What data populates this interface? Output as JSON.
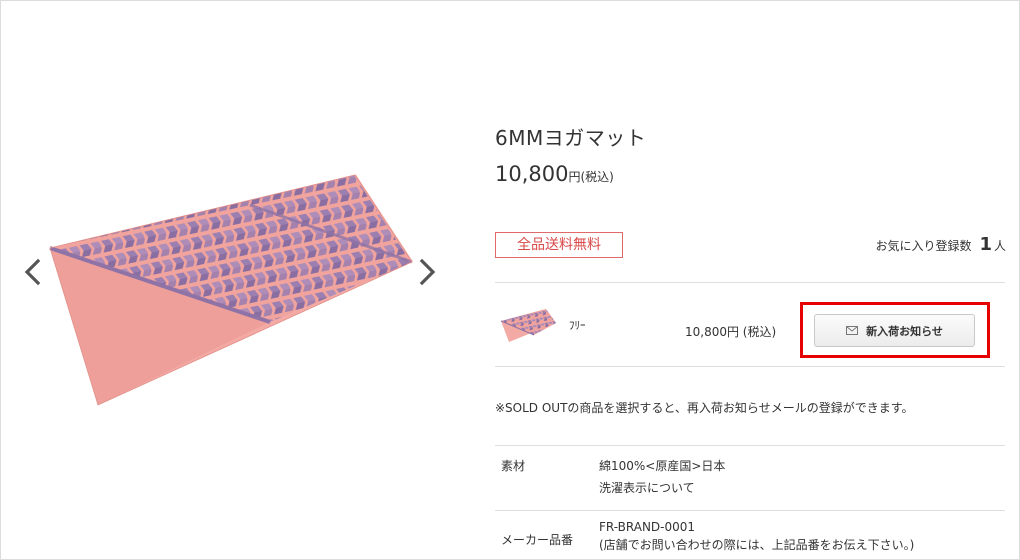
{
  "product": {
    "title": "6MMヨガマット",
    "price": "10,800",
    "price_unit": "円(税込)",
    "badge": "全品送料無料",
    "favorite_label": "お気に入り登録数",
    "favorite_count": "1",
    "favorite_unit": "人"
  },
  "variant": {
    "size": "ﾌﾘｰ",
    "price": "10,800円 (税込)",
    "notify_button": "新入荷お知らせ"
  },
  "note": "※SOLD OUTの商品を選択すると、再入荷お知らせメールの登録ができます。",
  "specs": [
    {
      "label": "素材",
      "value": "綿100%<原産国>日本",
      "link": "洗濯表示について"
    },
    {
      "label": "メーカー品番",
      "value": "FR-BRAND-0001",
      "value2": "(店舗でお問い合わせの際には、上記品番をお伝え下さい。)"
    }
  ],
  "colors": {
    "accent_red": "#e60000",
    "badge_red": "#d94a4a",
    "mat_pink": "#f2a5a0",
    "mat_purple": "#9b7fb0"
  },
  "icons": [
    "chevron-left-icon",
    "chevron-right-icon",
    "mail-icon"
  ]
}
